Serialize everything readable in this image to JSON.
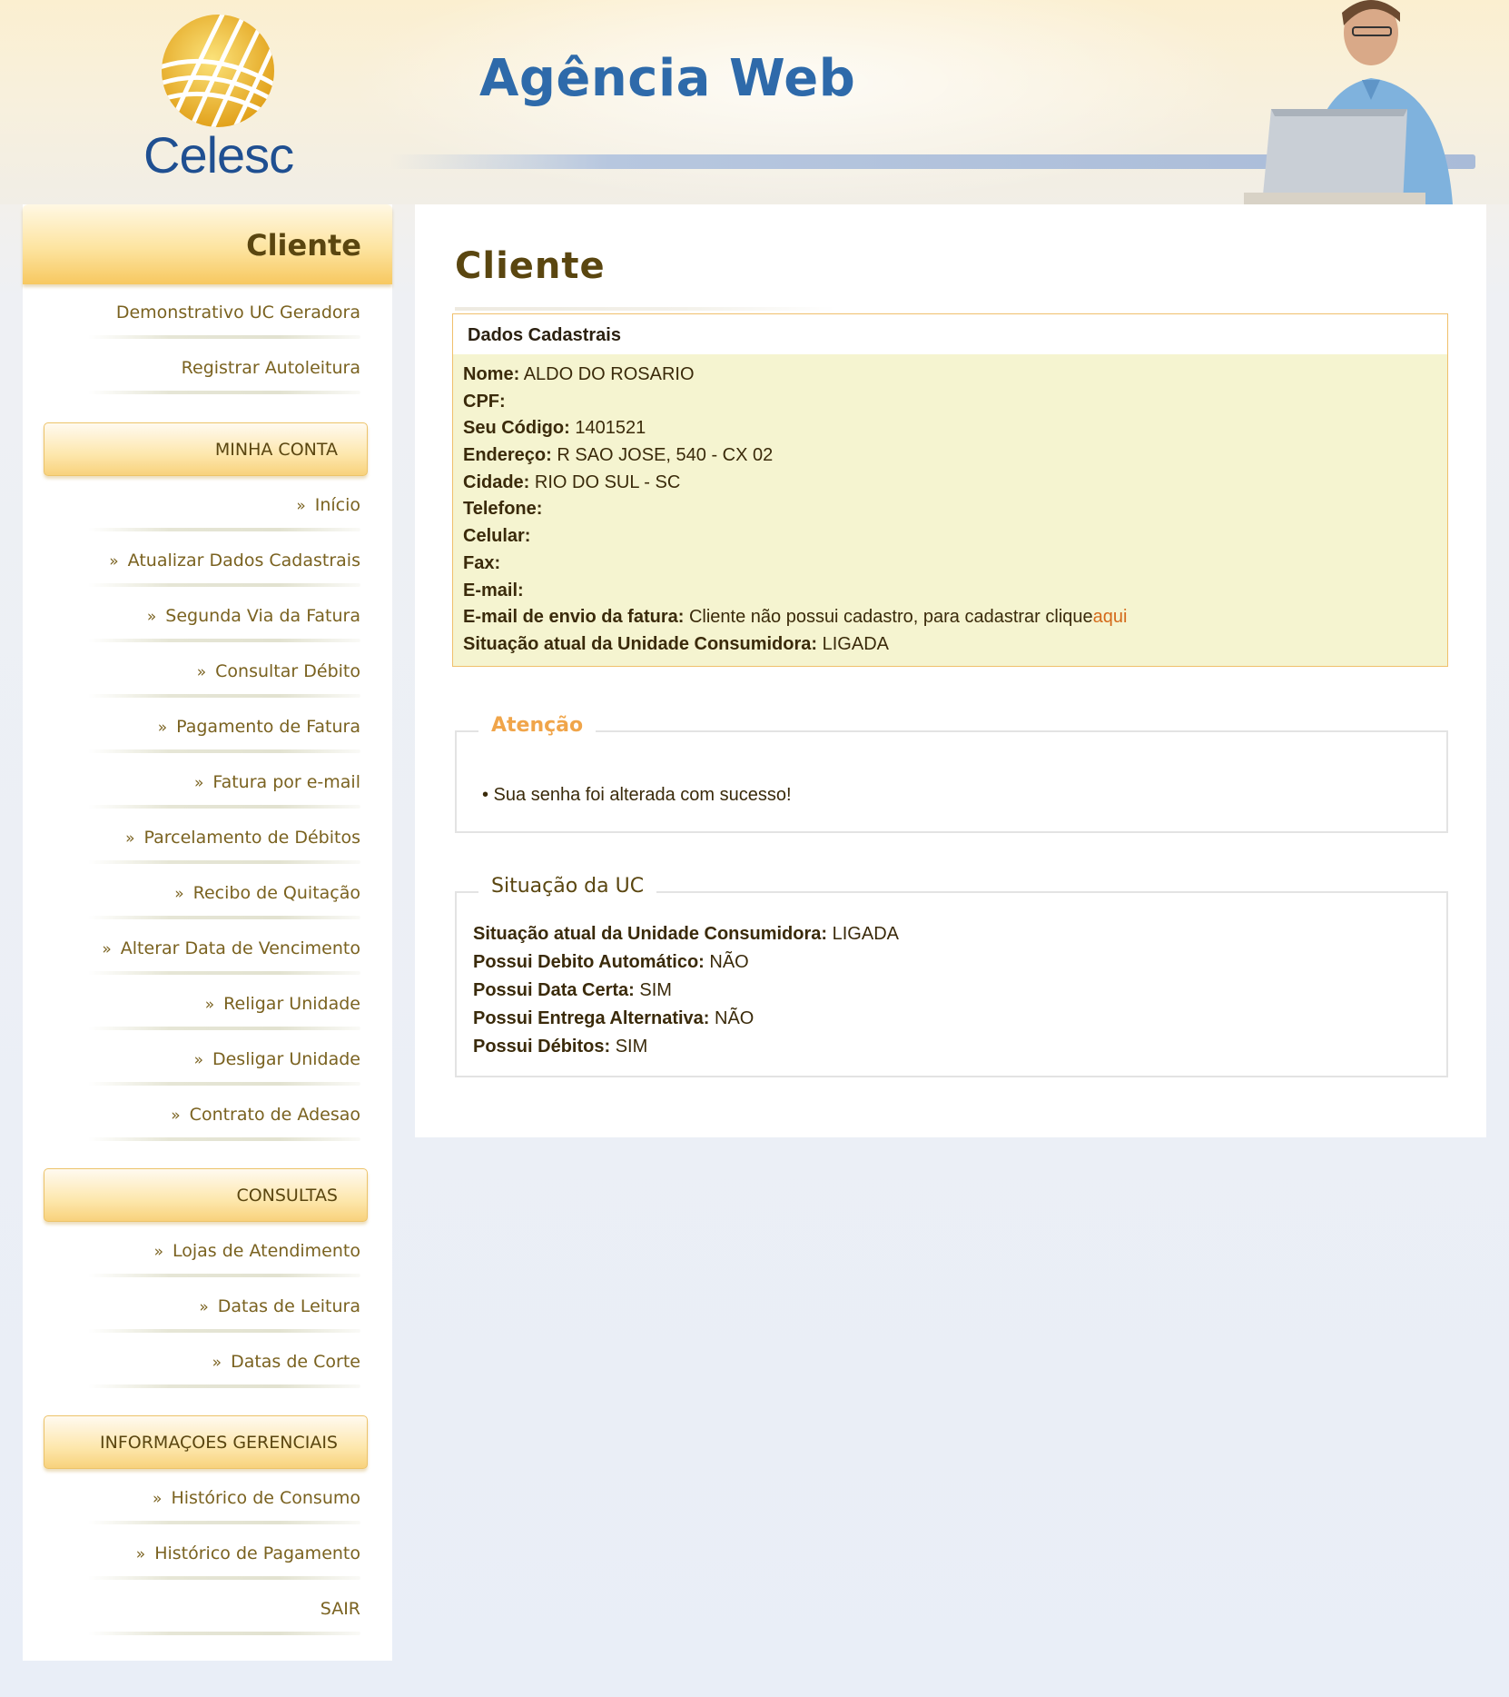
{
  "header": {
    "logo_text": "Celesc",
    "site_title": "Agência Web",
    "brand_blue": "#1f4f91",
    "brand_gold": "#e8b22a"
  },
  "sidebar": {
    "title": "Cliente",
    "top_items": [
      {
        "label": "Demonstrativo UC Geradora"
      },
      {
        "label": "Registrar Autoleitura"
      }
    ],
    "sections": [
      {
        "title": "MINHA CONTA",
        "items": [
          {
            "label": "Início"
          },
          {
            "label": "Atualizar Dados Cadastrais"
          },
          {
            "label": "Segunda Via da Fatura"
          },
          {
            "label": "Consultar Débito"
          },
          {
            "label": "Pagamento de Fatura"
          },
          {
            "label": "Fatura por e-mail"
          },
          {
            "label": "Parcelamento de Débitos"
          },
          {
            "label": "Recibo de Quitação"
          },
          {
            "label": "Alterar Data de Vencimento"
          },
          {
            "label": "Religar Unidade"
          },
          {
            "label": "Desligar Unidade"
          },
          {
            "label": "Contrato de Adesao"
          }
        ]
      },
      {
        "title": "CONSULTAS",
        "items": [
          {
            "label": "Lojas de Atendimento"
          },
          {
            "label": "Datas de Leitura"
          },
          {
            "label": "Datas de Corte"
          }
        ]
      },
      {
        "title": "INFORMAÇOES GERENCIAIS",
        "items": [
          {
            "label": "Histórico de Consumo"
          },
          {
            "label": "Histórico de Pagamento"
          }
        ]
      }
    ],
    "raquo": "»",
    "logout": "SAIR"
  },
  "main": {
    "page_title": "Cliente",
    "dados": {
      "heading": "Dados Cadastrais",
      "fields": [
        {
          "label": "Nome:",
          "value": "ALDO DO ROSARIO"
        },
        {
          "label": "CPF:",
          "value": ""
        },
        {
          "label": "Seu Código:",
          "value": "1401521"
        },
        {
          "label": "Endereço:",
          "value": "R SAO JOSE, 540 - CX 02"
        },
        {
          "label": "Cidade:",
          "value": "RIO DO SUL - SC"
        },
        {
          "label": "Telefone:",
          "value": ""
        },
        {
          "label": "Celular:",
          "value": ""
        },
        {
          "label": "Fax:",
          "value": ""
        },
        {
          "label": "E-mail:",
          "value": ""
        },
        {
          "label": "E-mail de envio da fatura:",
          "value": "Cliente não possui cadastro, para cadastrar clique",
          "link": "aqui"
        },
        {
          "label": "Situação atual da Unidade Consumidora:",
          "value": "LIGADA"
        }
      ]
    },
    "atencao": {
      "legend": "Atenção",
      "message": "• Sua senha foi alterada com sucesso!"
    },
    "situacao": {
      "legend": "Situação da UC",
      "fields": [
        {
          "label": "Situação atual da Unidade Consumidora:",
          "value": "LIGADA"
        },
        {
          "label": "Possui Debito Automático:",
          "value": "NÃO"
        },
        {
          "label": "Possui Data Certa:",
          "value": "SIM"
        },
        {
          "label": "Possui Entrega Alternativa:",
          "value": "NÃO"
        },
        {
          "label": "Possui Débitos:",
          "value": "SIM"
        }
      ]
    }
  }
}
